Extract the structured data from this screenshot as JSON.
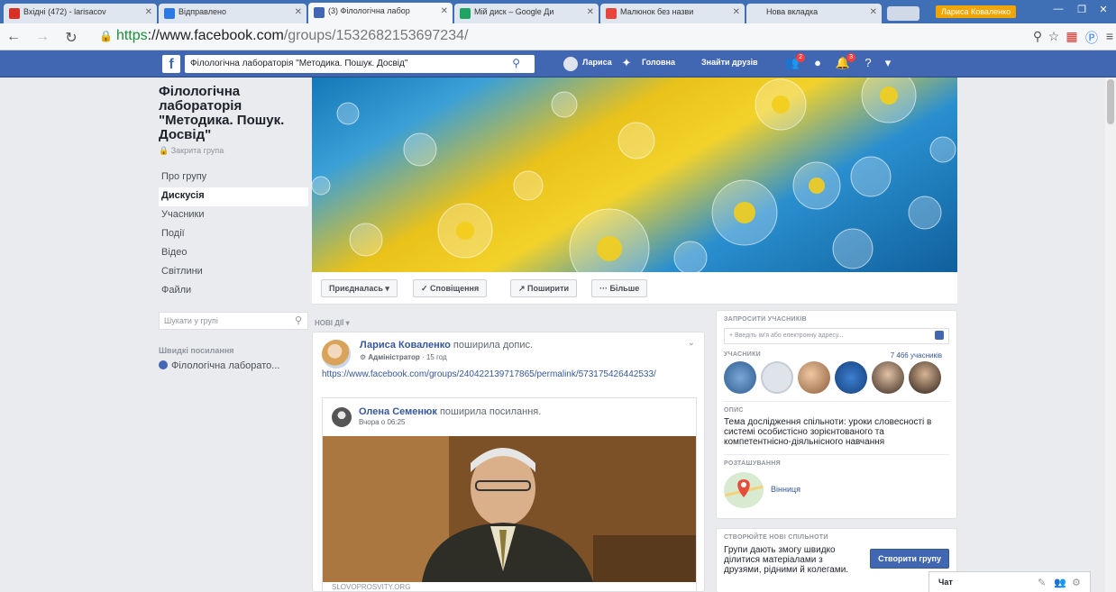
{
  "browser": {
    "tabs": [
      {
        "title": "Вхідні (472) - larisacov",
        "favicon_color": "#d93025"
      },
      {
        "title": "Відправлено",
        "favicon_color": "#2c7be5"
      },
      {
        "title": "(3) Філологічна лабор",
        "favicon_color": "#4267b2"
      },
      {
        "title": "Мій диск – Google Ди",
        "favicon_color": "#1fa463"
      },
      {
        "title": "Малюнок без назви",
        "favicon_color": "#e8453c"
      },
      {
        "title": "Нова вкладка",
        "favicon_color": "#cccccc"
      }
    ],
    "window_user": "Лариса Коваленко",
    "url_https": "https",
    "url_host": "://www.facebook.com",
    "url_path": "/groups/1532682153697234/"
  },
  "fbbar": {
    "search_value": "Філологічна лабораторія \"Методика. Пошук. Досвід\"",
    "user_name": "Лариса",
    "home": "Головна",
    "find_friends": "Знайти друзів",
    "notif_friends": "2",
    "notif_alerts": "3"
  },
  "group": {
    "title": "Філологічна лабораторія \"Методика. Пошук. Досвід\"",
    "privacy": "Закрита група",
    "nav": [
      "Про групу",
      "Дискусія",
      "Учасники",
      "Події",
      "Відео",
      "Світлини",
      "Файли"
    ],
    "active_nav": "Дискусія",
    "search_placeholder": "Шукати у групі",
    "shortcuts_heading": "Швидкі посилання",
    "shortcut_item": "Філологічна лаборато..."
  },
  "actions": {
    "joined": "Приєдналась ▾",
    "notifications": "✓ Сповіщення",
    "share": "↗ Поширити",
    "more": "··· Більше"
  },
  "feed": {
    "heading": "НОВІ ДІЇ ▾",
    "post": {
      "author": "Лариса Коваленко",
      "action": " поширила допис.",
      "role": "Адміністратор",
      "time": "· 15 год",
      "link": "https://www.facebook.com/groups/240422139717865/permalink/573175426442533/",
      "shared_author": "Олена Семенюк",
      "shared_action": " поширила посилання.",
      "shared_time": "Вчора о 06:25",
      "domain": "SLOVOPROSVITY.ORG"
    }
  },
  "right": {
    "invite_heading": "ЗАПРОСИТИ УЧАСНИКІВ",
    "invite_placeholder": "+ Введіть ім'я або електронну адресу...",
    "members_heading": "УЧАСНИКИ",
    "members_count": "7 466 учасників",
    "desc_heading": "ОПИС",
    "description": "Тема дослідження спільноти: уроки словесності в системі особистісно зорієнтованого та компетентнісно-діяльнісного навчання",
    "location_heading": "РОЗТАШУВАННЯ",
    "location": "Вінниця",
    "create_heading": "СТВОРЮЙТЕ НОВІ СПІЛЬНОТИ",
    "create_text": "Групи дають змогу швидко ділитися матеріалами з друзями, рідними й колегами.",
    "create_button": "Створити групу"
  },
  "chat": {
    "label": "Чат"
  },
  "colors": {
    "fb_blue": "#4267b2",
    "link": "#365899",
    "page_bg": "#e9ebee"
  }
}
